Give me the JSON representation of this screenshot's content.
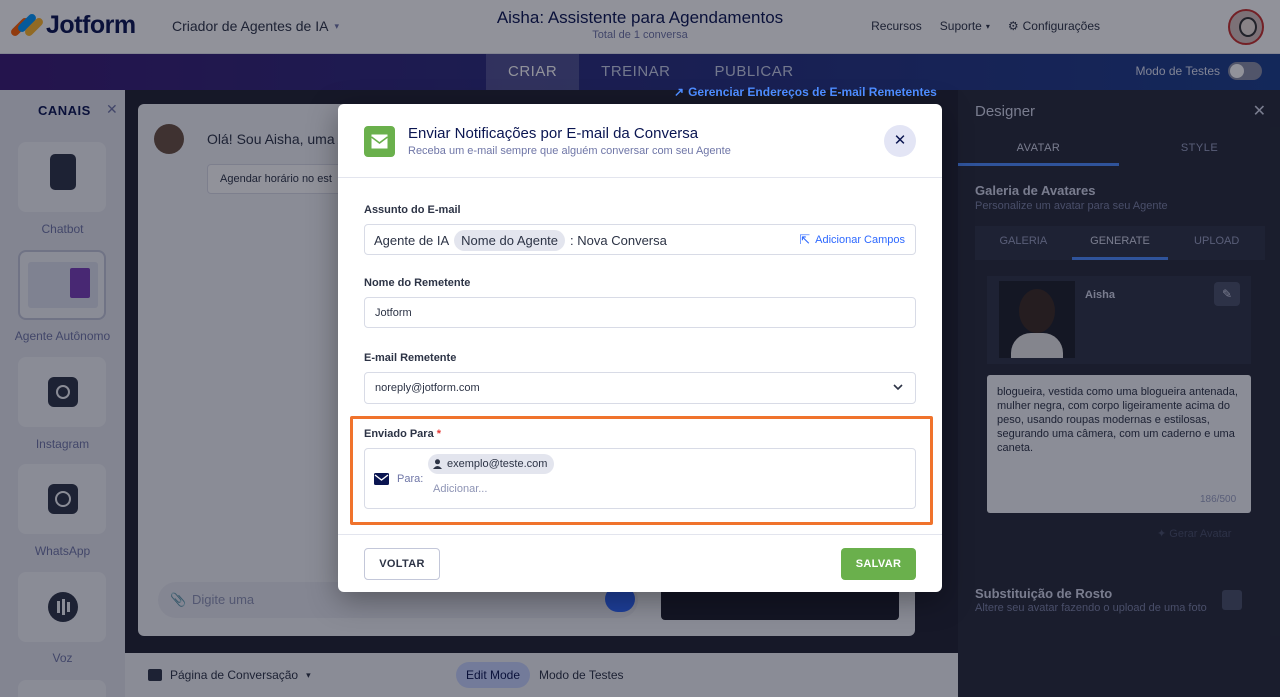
{
  "header": {
    "logo_text": "Jotform",
    "app_switch": "Criador de Agentes de IA",
    "title": "Aisha: Assistente para Agendamentos",
    "subtitle": "Total de 1 conversa",
    "links": {
      "resources": "Recursos",
      "support": "Suporte",
      "settings": "Configurações"
    }
  },
  "tabbar": {
    "tabs": [
      {
        "label": "CRIAR"
      },
      {
        "label": "TREINAR"
      },
      {
        "label": "PUBLICAR"
      }
    ],
    "test_mode": "Modo de Testes"
  },
  "sidebar": {
    "title": "CANAIS",
    "channels": [
      {
        "label": "Chatbot"
      },
      {
        "label": "Agente Autônomo"
      },
      {
        "label": "Instagram"
      },
      {
        "label": "WhatsApp"
      },
      {
        "label": "Voz"
      }
    ]
  },
  "chat": {
    "greeting": "Olá! Sou Aisha, uma Ag",
    "chip": "Agendar horário no est",
    "input_placeholder": "Digite uma",
    "manage_link": "Gerenciar Endereços de E-mail Remetentes"
  },
  "bottom": {
    "page_select": "Página de Conversação",
    "edit_mode": "Edit Mode",
    "test_mode": "Modo de Testes"
  },
  "designer": {
    "title": "Designer",
    "tabs": [
      "AVATAR",
      "STYLE"
    ],
    "gallery_title": "Galeria de Avatares",
    "gallery_subtitle": "Personalize um avatar para seu Agente",
    "gallery_tabs": [
      "GALERIA",
      "GENERATE",
      "UPLOAD"
    ],
    "agent_name": "Aisha",
    "prompt": "blogueira, vestida como uma blogueira antenada, mulher negra, com corpo ligeiramente acima do peso, usando roupas modernas e estilosas, segurando uma câmera, com um caderno e uma caneta.",
    "prompt_count": "186/500",
    "generate_button": "Gerar Avatar",
    "face_title": "Substituição de Rosto",
    "face_subtitle": "Altere seu avatar fazendo o upload de uma foto"
  },
  "modal": {
    "title": "Enviar Notificações por E-mail da Conversa",
    "subtitle": "Receba um e-mail sempre que alguém conversar com seu Agente",
    "subject": {
      "label": "Assunto do E-mail",
      "prefix": "Agente de IA",
      "tag": "Nome do Agente",
      "suffix": ": Nova Conversa",
      "add_fields": "Adicionar Campos"
    },
    "sender_name": {
      "label": "Nome do Remetente",
      "value": "Jotform"
    },
    "sender_email": {
      "label": "E-mail Remetente",
      "value": "noreply@jotform.com"
    },
    "send_to": {
      "label": "Enviado Para",
      "required_mark": "*",
      "to_label": "Para:",
      "recipient": "exemplo@teste.com",
      "add_placeholder": "Adicionar..."
    },
    "back_button": "VOLTAR",
    "save_button": "SALVAR"
  },
  "colors": {
    "accent_green": "#6ab04c",
    "highlight_orange": "#f0732c",
    "link_blue": "#2e69ff"
  }
}
